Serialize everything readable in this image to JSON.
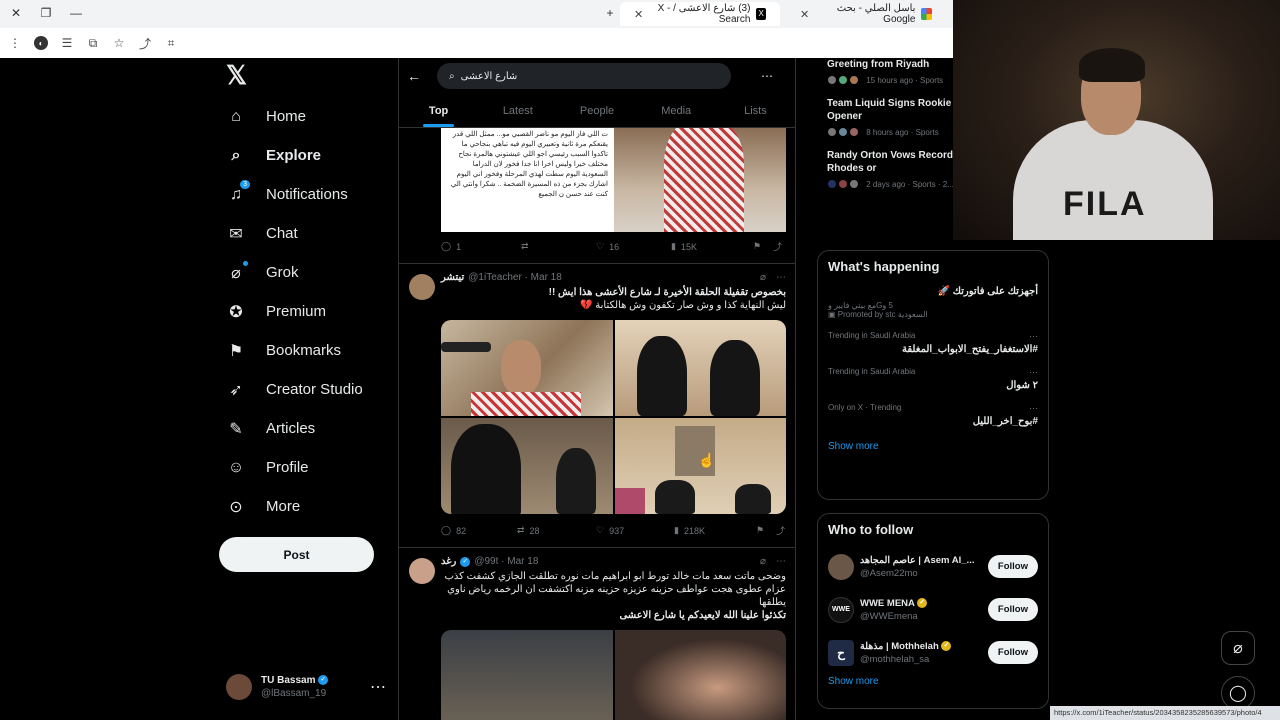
{
  "browser": {
    "tabs": [
      {
        "title": "(3) شارع الاعشى / X - Search",
        "active": true,
        "favicon": "x-icon"
      },
      {
        "title": "باسل الصلي - بحث Google",
        "active": false,
        "favicon": "google-icon"
      }
    ],
    "status_url": "https://x.com/1iTeacher/status/2034358235285639573/photo/4"
  },
  "nav": {
    "logo": "𝕏",
    "items": [
      {
        "label": "Home",
        "icon": "home-icon"
      },
      {
        "label": "Explore",
        "icon": "search-icon"
      },
      {
        "label": "Notifications",
        "icon": "bell-icon",
        "badge": "3"
      },
      {
        "label": "Chat",
        "icon": "mail-icon"
      },
      {
        "label": "Grok",
        "icon": "grok-icon"
      },
      {
        "label": "Premium",
        "icon": "premium-icon"
      },
      {
        "label": "Bookmarks",
        "icon": "bookmark-icon"
      },
      {
        "label": "Creator Studio",
        "icon": "rocket-icon"
      },
      {
        "label": "Articles",
        "icon": "articles-icon"
      },
      {
        "label": "Profile",
        "icon": "person-icon"
      },
      {
        "label": "More",
        "icon": "more-circle-icon"
      }
    ],
    "post_label": "Post",
    "account": {
      "name": "TU Bassam",
      "handle": "@lBassam_19"
    }
  },
  "search": {
    "query": "شارع الاعشى",
    "tabs": [
      "Top",
      "Latest",
      "People",
      "Media",
      "Lists"
    ]
  },
  "tweets": [
    {
      "replies": "1",
      "retweets": "",
      "likes": "16",
      "views": "15K",
      "image_text": "ت اللي فاز اليوم مو ناصر القصبي مو... ممثل اللي قدر يقنعكم مرة ثانية وتعبيري اليوم فيه تباهي بنجاحي ما تاكدوا السبب رئيسي اجو اللي عيشتوني هالمرة نجاح مختلف خيرا وليس اخرا انا جدا فخور لان الدراما السعودية اليوم سطت لهذي المرحلة وفخور اني اليوم اشارك بجزء من ذه المسيرة الضخمة .. شكرا وانتي الي كنت عند حسن ن الجميع"
    },
    {
      "name": "تيتشر",
      "handle": "@1iTeacher",
      "date": "Mar 18",
      "text1": "بخصوص تقفيلة الحلقة الأخيرة لـ شارع الأعشى هذا ايش !!",
      "text2": "ليش النهاية كذا و وش صار تكفون وش هالكتابة 💔",
      "replies": "82",
      "retweets": "28",
      "likes": "937",
      "views": "218K"
    },
    {
      "name": "رغد",
      "handle": "@99t",
      "date": "Mar 18",
      "text1": "وضحى ماتت سعد مات خالد تورط ابو ابراهيم مات نوره تطلقت الجازي كشفت كذب عزام عطوى هجت عواطف حزينه عزيزه حزينه مزنه اكتشفت ان الرخمه رياض ناوي يطلقها",
      "text2": "تكذئوا علينا الله لايعيدكم يا شارع الاعشى"
    }
  ],
  "sports_news": [
    {
      "title": "Greeting from Riyadh",
      "meta": "15 hours ago · Sports"
    },
    {
      "title": "Team Liquid Signs Rookie Before OWCS Opener",
      "meta": "8 hours ago · Sports"
    },
    {
      "title": "Randy Orton Vows Record Betraying Cody Rhodes or",
      "meta": "2 days ago · Sports · 2..."
    }
  ],
  "whats_happening": {
    "title": "What's happening",
    "promo": {
      "title": "أجهزتك على فاتورتك 🚀",
      "sub": "5 وGمع بيتي فايبر و",
      "promoted": "Promoted by stc السعودية"
    },
    "trends": [
      {
        "category": "Trending in Saudi Arabia",
        "name": "#الاستغفار_يفتح_الابواب_المغلقة"
      },
      {
        "category": "Trending in Saudi Arabia",
        "name": "٢ شوال"
      },
      {
        "category": "Only on X · Trending",
        "name": "#بوح_اخر_الليل"
      }
    ],
    "show_more": "Show more"
  },
  "who_to_follow": {
    "title": "Who to follow",
    "items": [
      {
        "name": "عاصم المجاهد | Asem Al_...",
        "handle": "@Asem22mo",
        "avatar": ""
      },
      {
        "name": "WWE MENA",
        "handle": "@WWEmena",
        "avatar": "WWE"
      },
      {
        "name": "مذهلة | Mothhelah",
        "handle": "@mothhelah_sa",
        "avatar": "ح"
      }
    ],
    "follow_label": "Follow",
    "show_more": "Show more"
  },
  "webcam": {
    "shirt_text": "FILA"
  },
  "colors": {
    "accent": "#1d9bf0",
    "bg": "#000000",
    "border": "#2f3336",
    "muted": "#71767b"
  }
}
